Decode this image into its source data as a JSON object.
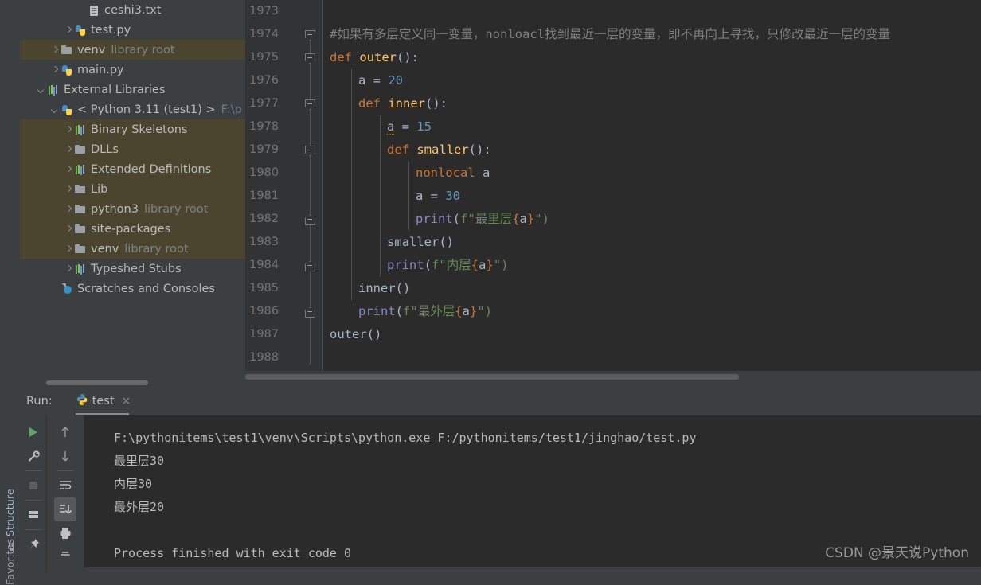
{
  "sidebar_strip": {
    "structure_label": "Structure",
    "favorites_label": "Favorites"
  },
  "project_tree": {
    "items": [
      {
        "label": "ceshi3.txt",
        "sub": "",
        "icon": "txt-file-icon",
        "arrow": "none",
        "indent": 72,
        "highlight": false
      },
      {
        "label": "test.py",
        "sub": "",
        "icon": "python-file-icon",
        "arrow": "right",
        "indent": 55,
        "highlight": false
      },
      {
        "label": "venv",
        "sub": "library root",
        "icon": "folder-icon",
        "arrow": "right",
        "indent": 38,
        "highlight": true
      },
      {
        "label": "main.py",
        "sub": "",
        "icon": "python-file-icon",
        "arrow": "right",
        "indent": 38,
        "highlight": false
      },
      {
        "label": "External Libraries",
        "sub": "",
        "icon": "library-icon",
        "arrow": "down",
        "indent": 21,
        "highlight": false
      },
      {
        "label": "< Python 3.11 (test1) >",
        "sub": "",
        "path": "F:\\p",
        "icon": "python-interpreter-icon",
        "arrow": "down",
        "indent": 38,
        "highlight": false
      },
      {
        "label": "Binary Skeletons",
        "sub": "",
        "icon": "library-icon",
        "arrow": "right",
        "indent": 55,
        "highlight": true
      },
      {
        "label": "DLLs",
        "sub": "",
        "icon": "folder-icon",
        "arrow": "right",
        "indent": 55,
        "highlight": true
      },
      {
        "label": "Extended Definitions",
        "sub": "",
        "icon": "library-icon",
        "arrow": "right",
        "indent": 55,
        "highlight": true
      },
      {
        "label": "Lib",
        "sub": "",
        "icon": "folder-icon",
        "arrow": "right",
        "indent": 55,
        "highlight": true
      },
      {
        "label": "python3",
        "sub": "library root",
        "icon": "folder-icon",
        "arrow": "right",
        "indent": 55,
        "highlight": true
      },
      {
        "label": "site-packages",
        "sub": "",
        "icon": "folder-icon",
        "arrow": "right",
        "indent": 55,
        "highlight": true
      },
      {
        "label": "venv",
        "sub": "library root",
        "icon": "folder-icon",
        "arrow": "right",
        "indent": 55,
        "highlight": true
      },
      {
        "label": "Typeshed Stubs",
        "sub": "",
        "icon": "library-icon",
        "arrow": "right",
        "indent": 55,
        "highlight": false
      },
      {
        "label": "Scratches and Consoles",
        "sub": "",
        "icon": "scratches-icon",
        "arrow": "none",
        "indent": 38,
        "highlight": false
      }
    ]
  },
  "editor": {
    "first_line_number": 1973,
    "line_numbers": [
      1973,
      1974,
      1975,
      1976,
      1977,
      1978,
      1979,
      1980,
      1981,
      1982,
      1983,
      1984,
      1985,
      1986,
      1987,
      1988
    ],
    "code_lines": [
      {
        "n": 1973,
        "text": ""
      },
      {
        "n": 1974,
        "text": "#如果有多层定义同一变量，nonloacl找到最近一层的变量，即不再向上寻找，只修改最近一层的变量"
      },
      {
        "n": 1975,
        "text": "def outer():"
      },
      {
        "n": 1976,
        "text": "    a = 20"
      },
      {
        "n": 1977,
        "text": "    def inner():"
      },
      {
        "n": 1978,
        "text": "        a = 15"
      },
      {
        "n": 1979,
        "text": "        def smaller():"
      },
      {
        "n": 1980,
        "text": "            nonlocal a"
      },
      {
        "n": 1981,
        "text": "            a = 30"
      },
      {
        "n": 1982,
        "text": "            print(f\"最里层{a}\")"
      },
      {
        "n": 1983,
        "text": "        smaller()"
      },
      {
        "n": 1984,
        "text": "        print(f\"内层{a}\")"
      },
      {
        "n": 1985,
        "text": "    inner()"
      },
      {
        "n": 1986,
        "text": "    print(f\"最外层{a}\")"
      },
      {
        "n": 1987,
        "text": "outer()"
      },
      {
        "n": 1988,
        "text": ""
      }
    ],
    "tokens": {
      "comment": "#如果有多层定义同一变量，nonloacl找到最近一层的变量，即不再向上寻找，只修改最近一层的变量",
      "kw_def": "def",
      "kw_nonlocal": "nonlocal",
      "fn_outer": "outer",
      "fn_inner": "inner",
      "fn_smaller": "smaller",
      "call_print": "print",
      "call_smaller": "smaller()",
      "call_inner": "inner()",
      "call_outer": "outer()",
      "var_a": "a",
      "num_20": "20",
      "num_15": "15",
      "num_30": "30",
      "str_innermost": "最里层",
      "str_inner": "内层",
      "str_outermost": "最外层",
      "fprefix": "f\"",
      "strend": "\")",
      "paren_colon": "():",
      "assign": " = ",
      "brace_open": "{",
      "brace_close": "}"
    },
    "colors": {
      "background": "#2b2b2b",
      "gutter": "#313335",
      "keyword": "#cc7832",
      "function": "#ffc66d",
      "number": "#6897bb",
      "call": "#8888c6",
      "string": "#6a8759",
      "comment": "#7f7f7f",
      "plain": "#a9b7c6"
    }
  },
  "run_panel": {
    "title": "Run:",
    "tab_label": "test",
    "close_label": "×",
    "toolbar_left": [
      "run-icon",
      "wrench-icon",
      "stop-icon",
      "layout-icon",
      "pin-icon"
    ],
    "toolbar_right": [
      "up-arrow-icon",
      "down-arrow-icon",
      "soft-wrap-icon",
      "scroll-to-end-icon",
      "print-icon",
      "trash-icon"
    ],
    "console_lines": [
      {
        "text": "F:\\pythonitems\\test1\\venv\\Scripts\\python.exe F:/pythonitems/test1/jinghao/test.py"
      },
      {
        "text": "最里层30"
      },
      {
        "text": "内层30"
      },
      {
        "text": "最外层20"
      },
      {
        "text": ""
      },
      {
        "text": "Process finished with exit code 0"
      }
    ]
  },
  "watermark": {
    "text": "CSDN @景天说Python"
  }
}
